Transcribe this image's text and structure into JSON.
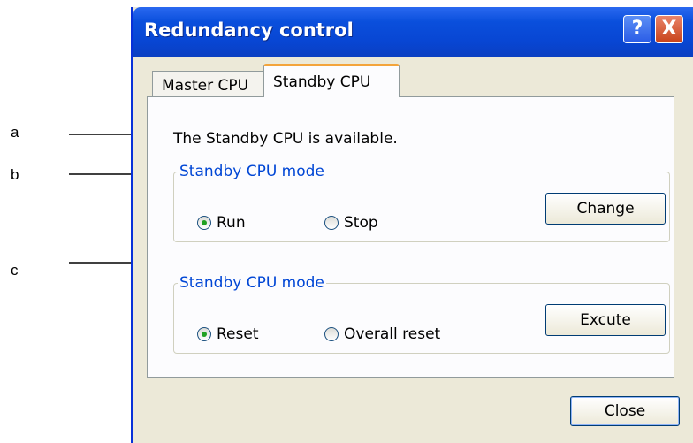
{
  "annotations": {
    "a": "a",
    "b": "b",
    "c": "c"
  },
  "window": {
    "title": "Redundancy control",
    "help_label": "?",
    "close_label": "X"
  },
  "tabs": [
    {
      "label": "Master CPU",
      "active": false
    },
    {
      "label": "Standby CPU",
      "active": true
    }
  ],
  "panel": {
    "status_text": "The Standby CPU is available.",
    "group1": {
      "legend": "Standby CPU mode",
      "options": [
        {
          "label": "Run",
          "checked": true
        },
        {
          "label": "Stop",
          "checked": false
        }
      ],
      "button_label": "Change"
    },
    "group2": {
      "legend": "Standby CPU mode",
      "options": [
        {
          "label": "Reset",
          "checked": true
        },
        {
          "label": "Overall reset",
          "checked": false
        }
      ],
      "button_label": "Excute"
    }
  },
  "footer": {
    "close_button_label": "Close"
  }
}
